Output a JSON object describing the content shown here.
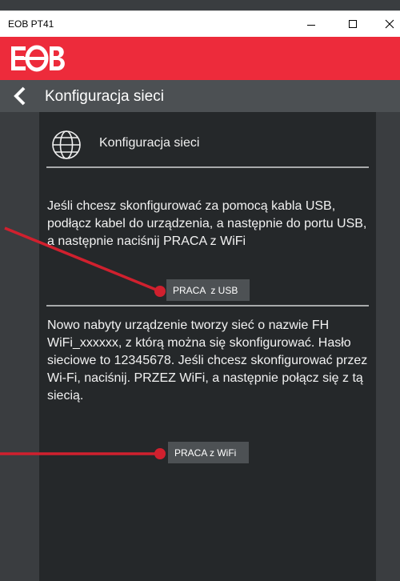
{
  "window": {
    "title": "EOB PT41"
  },
  "brand": {
    "logo_text": "EOB",
    "accent_color": "#ed2b3b"
  },
  "nav": {
    "title": "Konfiguracja sieci"
  },
  "section": {
    "title": "Konfiguracja sieci",
    "icon": "globe-icon"
  },
  "usb": {
    "description": "Jeśli chcesz skonfigurować za pomocą kabla USB, podłącz kabel do urządzenia, a następnie do portu USB, a następnie naciśnij PRACA z WiFi",
    "button_label": "PRACA  z USB"
  },
  "wifi": {
    "description": "Nowo nabyty urządzenie tworzy sieć o nazwie FH WiFi_xxxxxx, z którą można się skonfigurować. Hasło sieciowe to 12345678. Jeśli chcesz skonfigurować przez Wi-Fi, naciśnij. PRZEZ WiFi, a następnie połącz się z tą siecią.",
    "button_label": "PRACA z WiFi"
  },
  "annotation_color": "#d0202e"
}
